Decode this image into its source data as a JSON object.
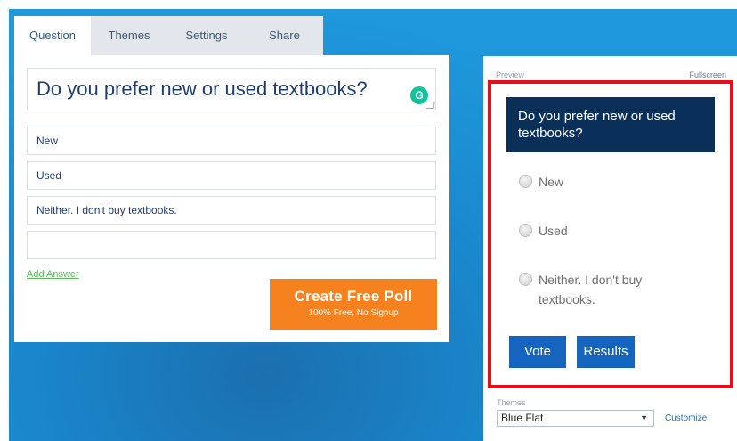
{
  "tabs": [
    "Question",
    "Themes",
    "Settings",
    "Share"
  ],
  "editor": {
    "question": "Do you prefer new or used textbooks?",
    "answers": [
      "New",
      "Used",
      "Neither. I don't buy textbooks.",
      ""
    ],
    "add_answer": "Add Answer",
    "create_button": {
      "title": "Create Free Poll",
      "subtitle": "100% Free, No Signup"
    }
  },
  "preview": {
    "label": "Preview",
    "fullscreen": "Fullscreen",
    "poll_question": "Do you prefer new or used textbooks?",
    "options": [
      "New",
      "Used",
      "Neither. I don't buy textbooks."
    ],
    "vote_label": "Vote",
    "results_label": "Results",
    "themes_label": "Themes",
    "theme_selected": "Blue Flat",
    "customize": "Customize"
  },
  "colors": {
    "background_blue": "#1f97dc",
    "header_navy": "#0a3059",
    "button_blue": "#1565c0",
    "cta_orange": "#f6821f",
    "frame_red": "#e3101b",
    "link_green": "#5cb85c"
  },
  "icons": {
    "grammarly": "grammarly-icon"
  }
}
